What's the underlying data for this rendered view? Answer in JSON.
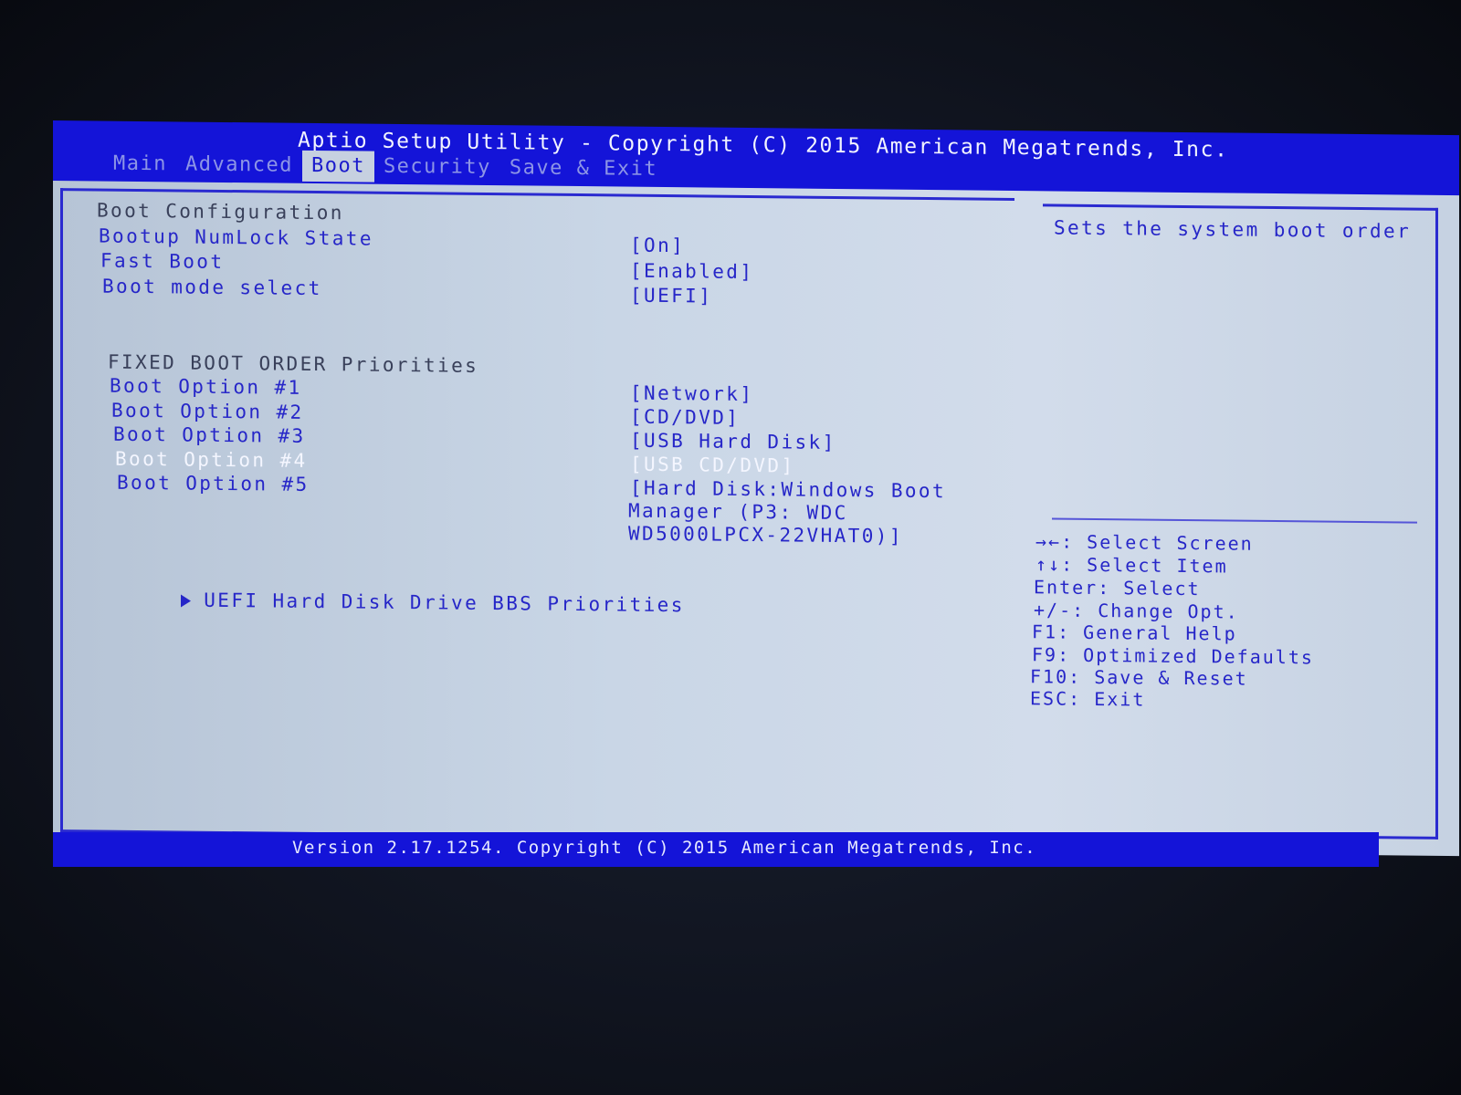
{
  "title": "Aptio Setup Utility - Copyright (C) 2015 American Megatrends, Inc.",
  "tabs": [
    {
      "label": "Main",
      "active": false
    },
    {
      "label": "Advanced",
      "active": false
    },
    {
      "label": "Boot",
      "active": true
    },
    {
      "label": "Security",
      "active": false
    },
    {
      "label": "Save & Exit",
      "active": false
    }
  ],
  "boot_config": {
    "header": "Boot Configuration",
    "items": [
      {
        "label": "Bootup NumLock State",
        "value": "[On]"
      },
      {
        "label": "Fast Boot",
        "value": "[Enabled]"
      },
      {
        "label": "Boot mode select",
        "value": "[UEFI]"
      }
    ]
  },
  "boot_order": {
    "header": "FIXED BOOT ORDER Priorities",
    "items": [
      {
        "label": "Boot Option #1",
        "value": "[Network]"
      },
      {
        "label": "Boot Option #2",
        "value": "[CD/DVD]"
      },
      {
        "label": "Boot Option #3",
        "value": "[USB Hard Disk]"
      },
      {
        "label": "Boot Option #4",
        "value": "[USB CD/DVD]",
        "selected": true
      },
      {
        "label": "Boot Option #5",
        "value_lines": [
          "[Hard Disk:Windows Boot",
          "Manager (P3: WDC",
          "WD5000LPCX-22VHAT0)]"
        ]
      }
    ]
  },
  "submenu": {
    "label": "UEFI Hard Disk Drive BBS Priorities",
    "icon": "triangle-right-icon"
  },
  "help": {
    "description": "Sets the system boot order",
    "keys": [
      "→←: Select Screen",
      "↑↓: Select Item",
      "Enter: Select",
      "+/-: Change Opt.",
      "F1: General Help",
      "F9: Optimized Defaults",
      "F10: Save & Reset",
      "ESC: Exit"
    ]
  },
  "footer": "Version 2.17.1254. Copyright (C) 2015 American Megatrends, Inc."
}
